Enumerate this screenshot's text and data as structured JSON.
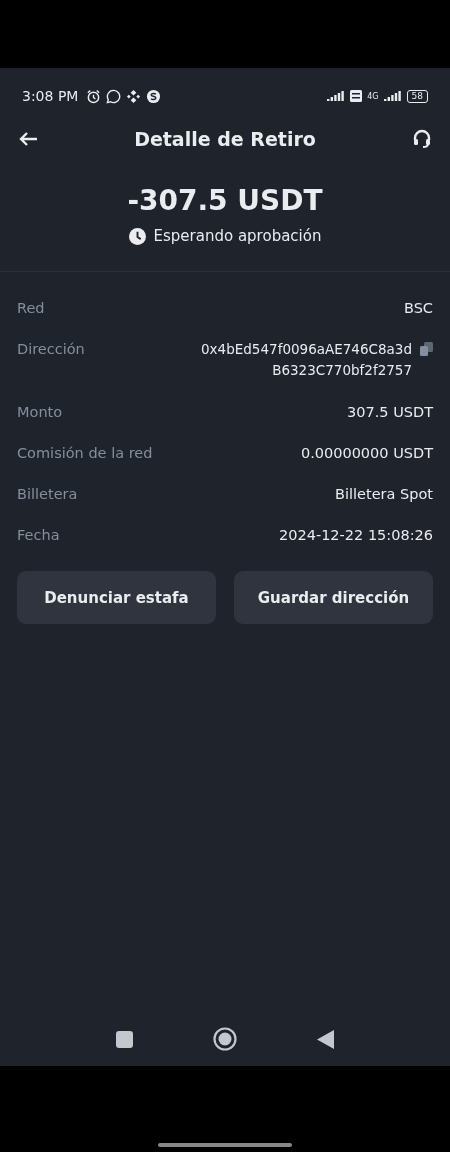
{
  "status_bar": {
    "time": "3:08 PM",
    "network": "4G",
    "battery": "58"
  },
  "header": {
    "title": "Detalle de Retiro"
  },
  "summary": {
    "amount": "-307.5 USDT",
    "status": "Esperando aprobación"
  },
  "details": [
    {
      "label": "Red",
      "value": "BSC",
      "kind": "text"
    },
    {
      "label": "Dirección",
      "value": "0x4bEd547f0096aAE746C8a3d",
      "value_line_2": "B6323C770bf2f2757",
      "kind": "address"
    },
    {
      "label": "Monto",
      "value": "307.5 USDT",
      "kind": "text"
    },
    {
      "label": "Comisión de la red",
      "value": "0.00000000 USDT",
      "kind": "text"
    },
    {
      "label": "Billetera",
      "value": "Billetera Spot",
      "kind": "text"
    },
    {
      "label": "Fecha",
      "value": "2024-12-22 15:08:26",
      "kind": "text"
    }
  ],
  "buttons": [
    "Denunciar estafa",
    "Guardar dirección"
  ]
}
